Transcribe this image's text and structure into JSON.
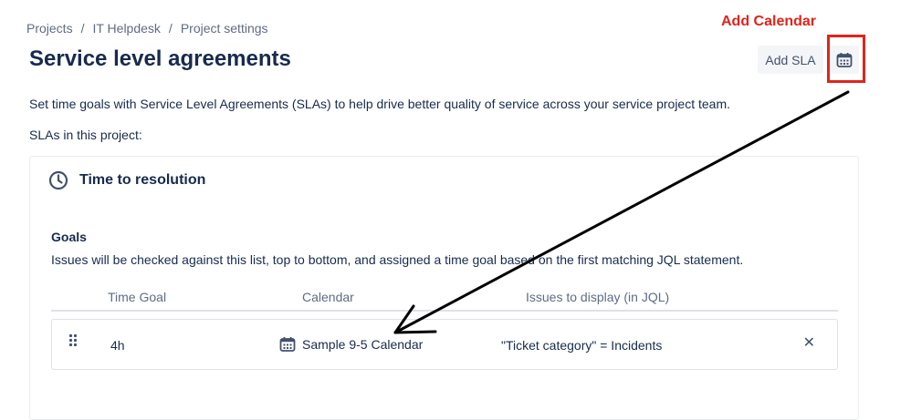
{
  "breadcrumb": [
    "Projects",
    "IT Helpdesk",
    "Project settings"
  ],
  "breadcrumb_sep": "/",
  "page_title": "Service level agreements",
  "annotation": {
    "label": "Add Calendar",
    "color": "#e2231a"
  },
  "header_actions": {
    "add_sla_label": "Add SLA",
    "calendar_icon": "calendar-icon"
  },
  "description": "Set time goals with Service Level Agreements (SLAs) to help drive better quality of service across your service project team.",
  "slas_label": "SLAs in this project:",
  "sla": {
    "name": "Time to resolution",
    "icon": "clock-icon",
    "goals_heading": "Goals",
    "goals_description": "Issues will be checked against this list, top to bottom, and assigned a time goal based on the first matching JQL statement.",
    "columns": [
      "Time Goal",
      "Calendar",
      "Issues to display (in JQL)"
    ],
    "rows": [
      {
        "time_goal": "4h",
        "calendar": "Sample 9-5 Calendar",
        "jql": "\"Ticket category\" = Incidents"
      }
    ]
  }
}
